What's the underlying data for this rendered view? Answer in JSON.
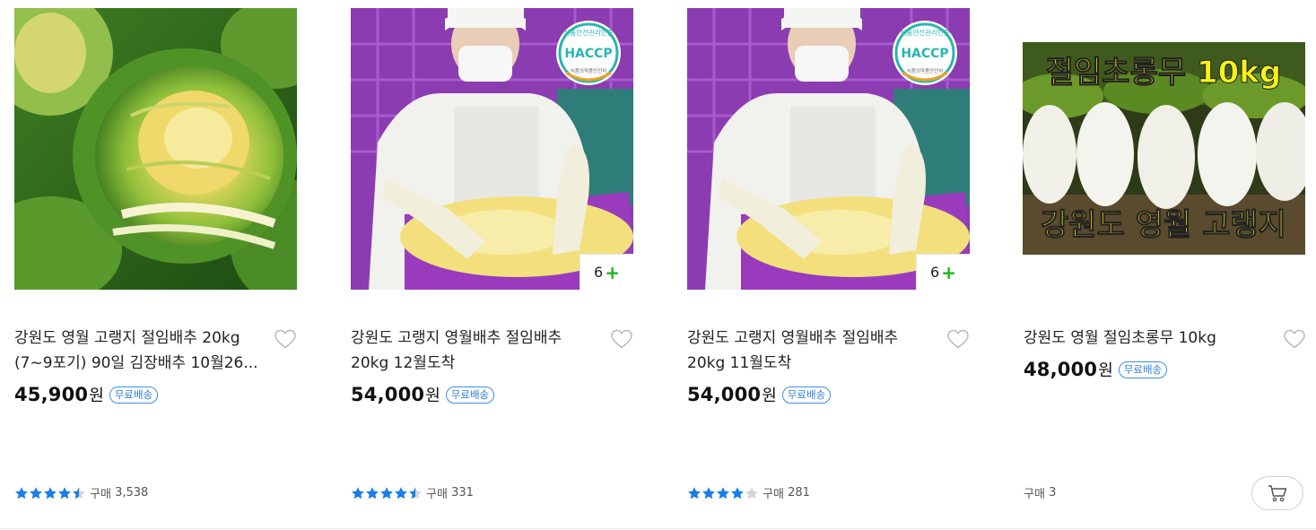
{
  "products": [
    {
      "title_line1": "강원도 영월 고랭지 절임배추 20kg",
      "title_line2": "(7~9포기) 90일 김장배추 10월26...",
      "price": "45,900",
      "currency": "원",
      "shipping_badge": "무료배송",
      "rating_stars": 4.5,
      "purchase_label": "구매",
      "purchase_count": "3,538",
      "image_icon": "napa-cabbage-photo"
    },
    {
      "title_line1": "강원도 고랭지 영월배추 절임배추",
      "title_line2": "20kg 12월도착",
      "price": "54,000",
      "currency": "원",
      "shipping_badge": "무료배송",
      "rating_stars": 4.5,
      "purchase_label": "구매",
      "purchase_count": "331",
      "more_images_count": "6",
      "haccp_top": "식품안전관리인증",
      "haccp_main": "HACCP",
      "haccp_bottom": "식품의약품안전처",
      "image_icon": "worker-salted-cabbage-photo"
    },
    {
      "title_line1": "강원도 고랭지 영월배추 절임배추",
      "title_line2": "20kg 11월도착",
      "price": "54,000",
      "currency": "원",
      "shipping_badge": "무료배송",
      "rating_stars": 4,
      "purchase_label": "구매",
      "purchase_count": "281",
      "more_images_count": "6",
      "haccp_top": "식품안전관리인증",
      "haccp_main": "HACCP",
      "haccp_bottom": "식품의약품안전처",
      "image_icon": "worker-salted-cabbage-photo"
    },
    {
      "title_line1": "강원도 영월 절임초롱무 10kg",
      "title_line2": "",
      "price": "48,000",
      "currency": "원",
      "shipping_badge": "무료배송",
      "purchase_label": "구매",
      "purchase_count": "3",
      "image_text_top": "절임초롱무 10kg",
      "image_text_bottom": "강원도 영월 고랭지",
      "image_icon": "radish-photo"
    }
  ],
  "colors": {
    "star_blue": "#1a7ee8",
    "star_empty": "#d5d5d5",
    "badge_blue": "#2b7fd8",
    "plus_green": "#1cb51c",
    "haccp_teal": "#29b6b0"
  },
  "icons": [
    "heart-outline-icon",
    "star-icon",
    "cart-icon",
    "plus-icon"
  ]
}
